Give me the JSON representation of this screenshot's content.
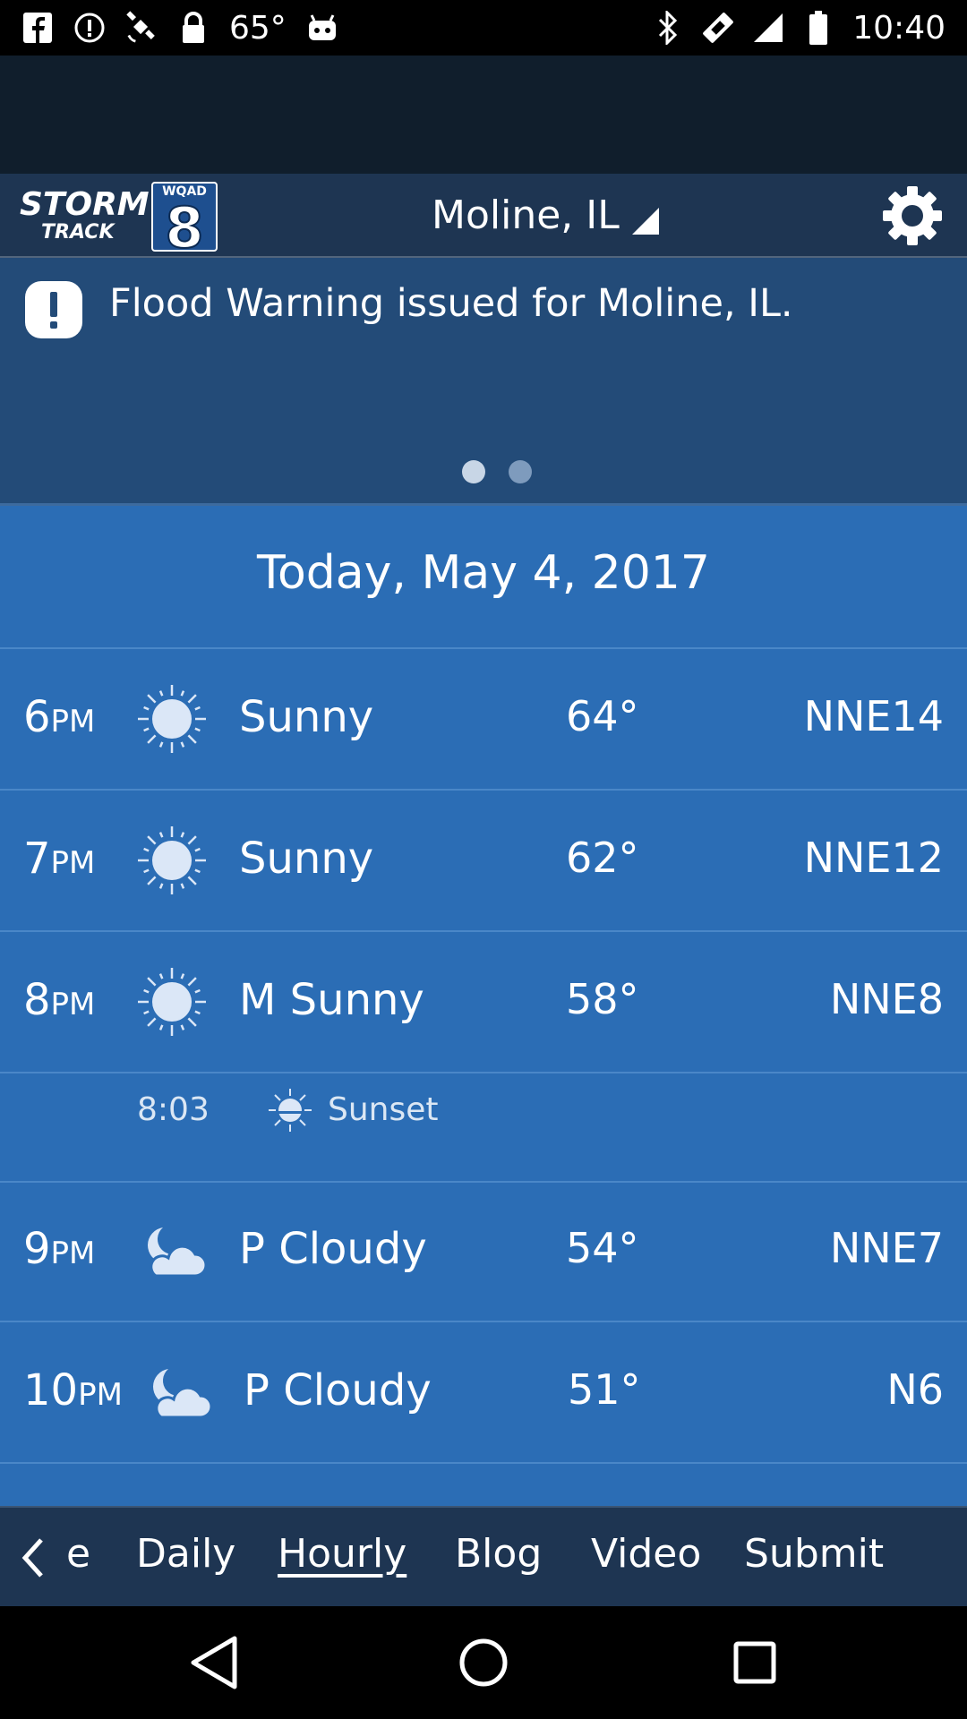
{
  "status_bar": {
    "temp": "65°",
    "time": "10:40",
    "icons": [
      "facebook-icon",
      "alert-circle-icon",
      "satellite-icon",
      "lock-icon",
      "android-icon",
      "bluetooth-icon",
      "vibrate-icon",
      "signal-icon",
      "battery-icon"
    ]
  },
  "header": {
    "logo": {
      "line1": "STORM",
      "line2": "TRACK",
      "station": "WQAD",
      "channel": "8"
    },
    "location": "Moline, IL",
    "settings_icon": "gear-icon"
  },
  "alert": {
    "text": "Flood Warning issued for Moline, IL.",
    "icon": "exclamation-icon",
    "page_count": 2,
    "active_page": 1
  },
  "date_header": "Today, May 4, 2017",
  "hourly": [
    {
      "hour": "6",
      "ampm": "PM",
      "icon": "sun-icon",
      "condition": "Sunny",
      "temp": "64°",
      "wind": "NNE14"
    },
    {
      "hour": "7",
      "ampm": "PM",
      "icon": "sun-icon",
      "condition": "Sunny",
      "temp": "62°",
      "wind": "NNE12"
    },
    {
      "hour": "8",
      "ampm": "PM",
      "icon": "sun-icon",
      "condition": "M Sunny",
      "temp": "58°",
      "wind": "NNE8"
    },
    {
      "hour": "9",
      "ampm": "PM",
      "icon": "moon-cloud-icon",
      "condition": "P Cloudy",
      "temp": "54°",
      "wind": "NNE7"
    },
    {
      "hour": "10",
      "ampm": "PM",
      "icon": "moon-cloud-icon",
      "condition": "P Cloudy",
      "temp": "51°",
      "wind": "N6"
    }
  ],
  "sunset": {
    "time": "8:03",
    "label": "Sunset",
    "icon": "sunset-icon"
  },
  "bottom_nav": {
    "back_icon": "chevron-left-icon",
    "items": [
      "e",
      "Daily",
      "Hourly",
      "Blog",
      "Video",
      "Submit"
    ],
    "active": "Hourly"
  },
  "system_nav": [
    "back-triangle-icon",
    "home-circle-icon",
    "recents-square-icon"
  ],
  "colors": {
    "list_bg": "#2b6db5",
    "alert_bg": "#234b78",
    "header_bg": "#1e3552",
    "ad_bg": "#101e2c",
    "icon_fill": "#dbe7f7"
  }
}
